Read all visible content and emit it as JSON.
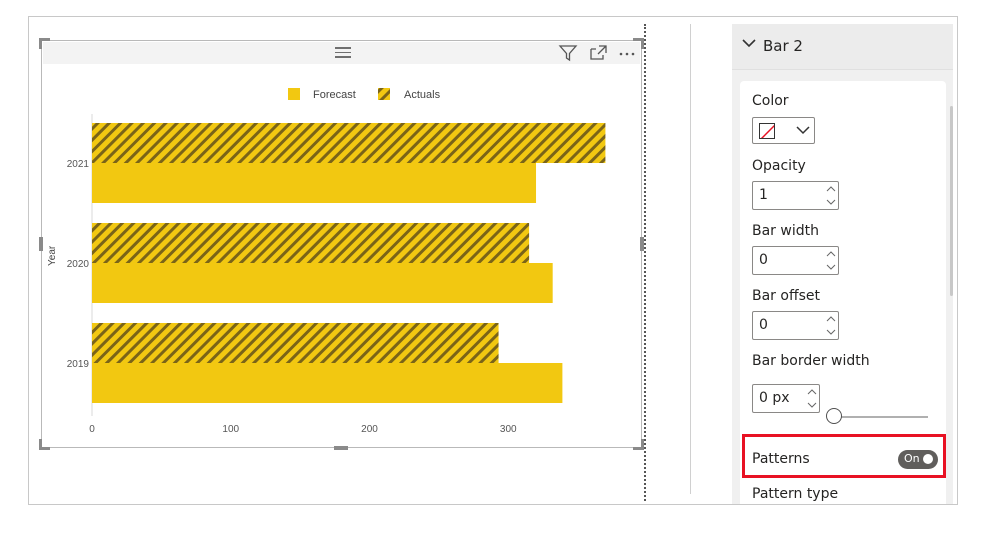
{
  "chart": {
    "legend": {
      "forecast": "Forecast",
      "actuals": "Actuals"
    },
    "y_axis_title": "Year"
  },
  "chart_data": {
    "type": "bar",
    "orientation": "horizontal",
    "categories": [
      "2021",
      "2020",
      "2019"
    ],
    "series": [
      {
        "name": "Actuals",
        "values": [
          370,
          315,
          293
        ],
        "pattern": "diagonal-stripes"
      },
      {
        "name": "Forecast",
        "values": [
          320,
          332,
          339
        ]
      }
    ],
    "xlabel": "",
    "ylabel": "Year",
    "x_ticks": [
      "0",
      "100",
      "200",
      "300"
    ],
    "xlim": [
      0,
      387
    ],
    "legend_position": "top-center",
    "grid": false,
    "colors": {
      "bar": "#F2C811",
      "stripe": "#7a6418"
    }
  },
  "pane": {
    "section_title": "Bar 2",
    "color_label": "Color",
    "opacity_label": "Opacity",
    "opacity_value": "1",
    "bar_width_label": "Bar width",
    "bar_width_value": "0",
    "bar_offset_label": "Bar offset",
    "bar_offset_value": "0",
    "border_width_label": "Bar border width",
    "border_width_value": "0 px",
    "border_width_slider": 0,
    "patterns_label": "Patterns",
    "patterns_toggle": "On",
    "pattern_type_label": "Pattern type"
  },
  "icons": {
    "header": [
      "drag-handle-icon",
      "filter-icon",
      "focus-mode-icon",
      "more-options-icon"
    ],
    "pane": [
      "chevron-down-icon",
      "no-color-swatch-icon",
      "chevron-down-icon",
      "spin-arrows-icon"
    ]
  },
  "colors": {
    "highlight": "#E81123",
    "toggle": "#605E5C"
  }
}
